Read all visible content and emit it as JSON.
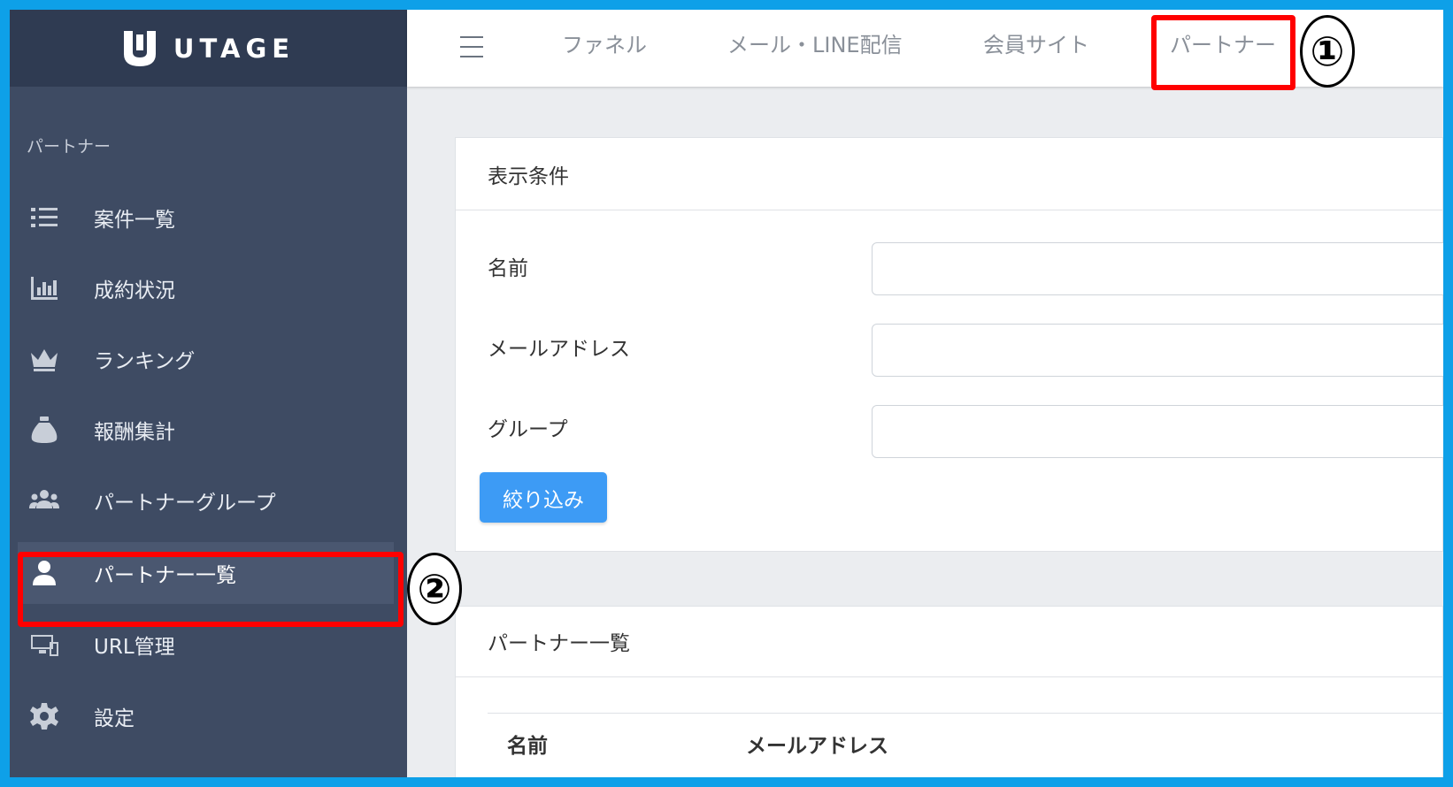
{
  "brand": {
    "name": "UTAGE",
    "logo_icon": "utage-logo-icon"
  },
  "header": {
    "menu_icon": "hamburger-icon",
    "nav": [
      {
        "label": "ファネル"
      },
      {
        "label": "メール・LINE配信"
      },
      {
        "label": "会員サイト"
      },
      {
        "label": "パートナー"
      }
    ]
  },
  "sidebar": {
    "section": "パートナー",
    "items": [
      {
        "label": "案件一覧",
        "icon": "list-icon"
      },
      {
        "label": "成約状況",
        "icon": "bar-chart-icon"
      },
      {
        "label": "ランキング",
        "icon": "crown-icon"
      },
      {
        "label": "報酬集計",
        "icon": "money-bag-icon"
      },
      {
        "label": "パートナーグループ",
        "icon": "users-icon"
      },
      {
        "label": "パートナー一覧",
        "icon": "user-icon",
        "active": true
      },
      {
        "label": "URL管理",
        "icon": "desktop-icon"
      },
      {
        "label": "設定",
        "icon": "gear-icon"
      }
    ]
  },
  "annotations": {
    "callout_1": "①",
    "callout_2": "②",
    "highlight_color": "#ff0000"
  },
  "filter": {
    "title": "表示条件",
    "fields": {
      "name": "名前",
      "email": "メールアドレス",
      "group": "グループ"
    },
    "button": "絞り込み"
  },
  "list": {
    "title": "パートナー一覧",
    "columns": [
      "名前",
      "メールアドレス"
    ]
  },
  "colors": {
    "sidebar": "#3e4b63",
    "brand_bar": "#2f3b52",
    "primary_button": "#3d9bf5",
    "frame": "#0ea0e8"
  }
}
